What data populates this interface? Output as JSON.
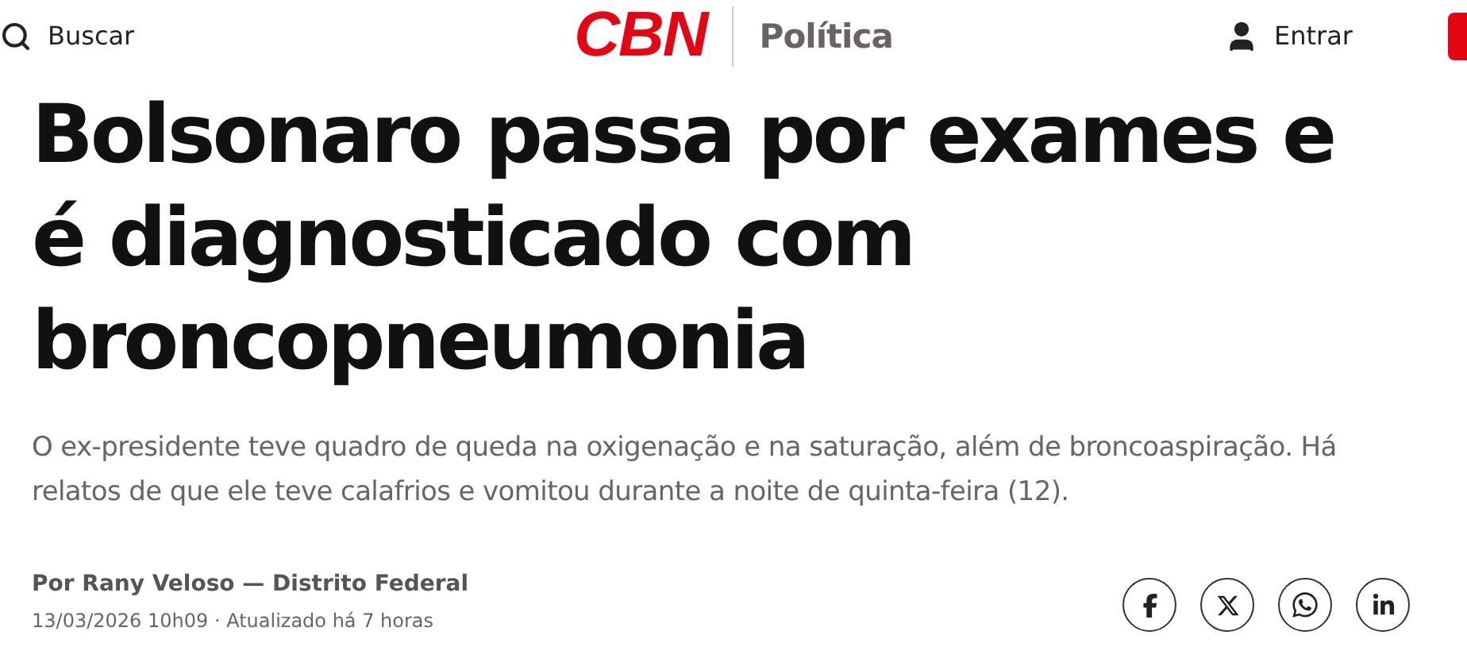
{
  "header": {
    "search_label": "Buscar",
    "logo": "CBN",
    "section": "Política",
    "login_label": "Entrar"
  },
  "article": {
    "title": "Bolsonaro passa por exames e é diagnosticado com broncopneumonia",
    "subtitle": "O ex-presidente teve quadro de queda na oxigenação e na saturação, além de broncoaspiração. Há relatos de que ele teve calafrios e vomitou durante a noite de quinta-feira (12).",
    "byline": "Por Rany Veloso — Distrito Federal",
    "date": "13/03/2026 10h09 · Atualizado há 7 horas"
  },
  "share": [
    {
      "kind": "facebook"
    },
    {
      "kind": "x"
    },
    {
      "kind": "whatsapp"
    },
    {
      "kind": "linkedin"
    }
  ]
}
